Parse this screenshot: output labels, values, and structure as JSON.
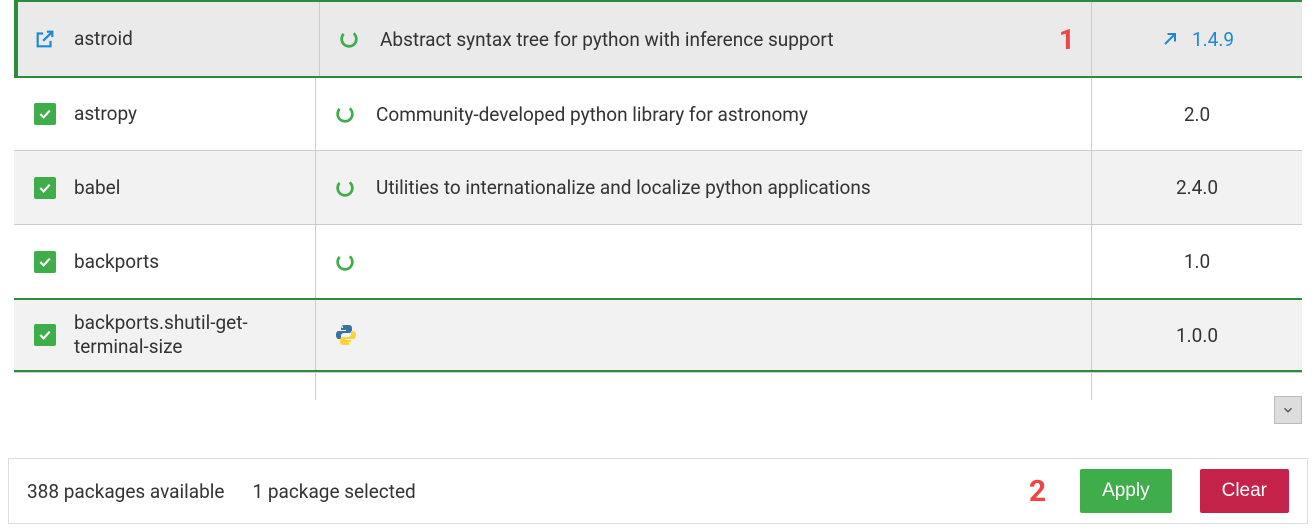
{
  "packages": [
    {
      "name": "astroid",
      "description": "Abstract syntax tree for python with inference support",
      "version": "1.4.9",
      "selected": true,
      "icon": "spinner",
      "upgrade": true
    },
    {
      "name": "astropy",
      "description": "Community-developed python library for astronomy",
      "version": "2.0",
      "selected": false,
      "icon": "spinner",
      "upgrade": false
    },
    {
      "name": "babel",
      "description": "Utilities to internationalize and localize python applications",
      "version": "2.4.0",
      "selected": false,
      "icon": "spinner",
      "upgrade": false
    },
    {
      "name": "backports",
      "description": "",
      "version": "1.0",
      "selected": false,
      "icon": "spinner",
      "upgrade": false
    },
    {
      "name": "backports.shutil-get-terminal-size",
      "description": "",
      "version": "1.0.0",
      "selected": false,
      "icon": "python",
      "upgrade": false
    }
  ],
  "callouts": {
    "one": "1",
    "two": "2"
  },
  "footer": {
    "available": "388 packages available",
    "selected": "1 package selected",
    "apply": "Apply",
    "clear": "Clear"
  }
}
